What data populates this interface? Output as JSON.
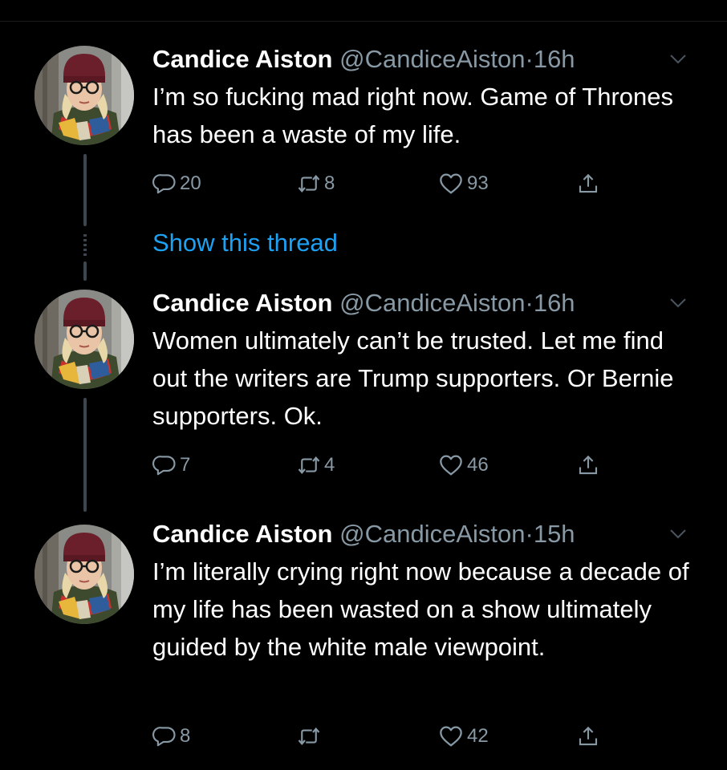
{
  "colors": {
    "background": "#000000",
    "text": "#ffffff",
    "muted": "#8899a6",
    "link": "#1da1f2",
    "thread_line": "#3d4650"
  },
  "icons": {
    "reply": "reply-icon",
    "retweet": "retweet-icon",
    "like": "heart-icon",
    "share": "share-icon",
    "menu": "chevron-down-icon"
  },
  "show_thread_label": "Show this thread",
  "tweets": [
    {
      "name": "Candice Aiston",
      "handle": "@CandiceAiston",
      "separator": "·",
      "time": "16h",
      "text": "I’m so fucking mad right now. Game of Thrones has been a waste of my life.",
      "replies": "20",
      "retweets": "8",
      "likes": "93"
    },
    {
      "name": "Candice Aiston",
      "handle": "@CandiceAiston",
      "separator": "·",
      "time": "16h",
      "text": "Women ultimately can’t be trusted. Let me find out the writers are Trump supporters. Or Bernie supporters. Ok.",
      "replies": "7",
      "retweets": "4",
      "likes": "46"
    },
    {
      "name": "Candice Aiston",
      "handle": "@CandiceAiston",
      "separator": "·",
      "time": "15h",
      "text": "I’m literally crying right now because a decade of my life has been wasted on a show ultimately guided by the white male viewpoint.",
      "replies": "8",
      "retweets": "",
      "likes": "42"
    }
  ]
}
